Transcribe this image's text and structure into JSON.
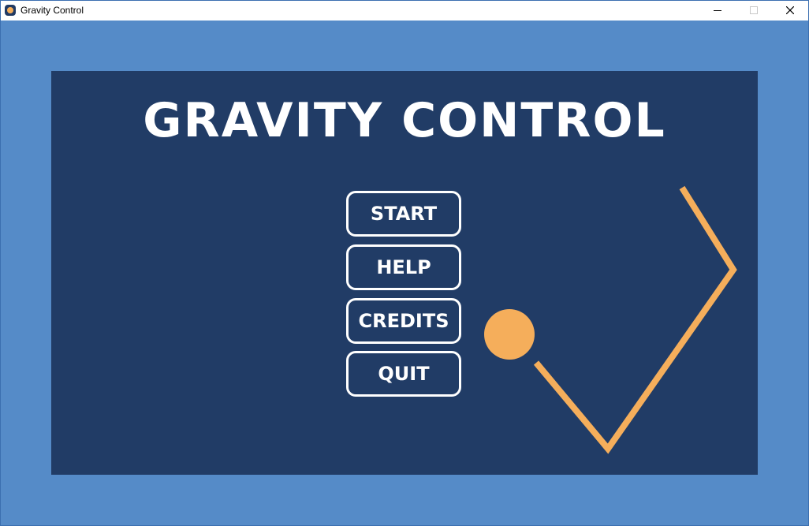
{
  "window": {
    "title": "Gravity Control",
    "controls": [
      "minimize",
      "maximize",
      "close"
    ]
  },
  "game": {
    "title": "GRAVITY CONTROL",
    "menu": [
      {
        "id": "start",
        "label": "START"
      },
      {
        "id": "help",
        "label": "HELP"
      },
      {
        "id": "credits",
        "label": "CREDITS"
      },
      {
        "id": "quit",
        "label": "QUIT"
      }
    ]
  },
  "colors": {
    "background": "#558bc8",
    "panel": "#213c66",
    "accent": "#f5ae5b",
    "text": "#ffffff"
  }
}
